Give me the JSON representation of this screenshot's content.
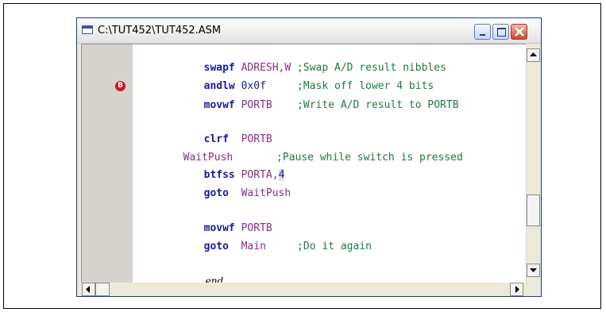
{
  "window": {
    "title": "C:\\TUT452\\TUT452.ASM"
  },
  "editor": {
    "breakpoint_marker": "B",
    "lines": [
      {
        "a": "swapf",
        "b": " ADRESH,W",
        "c": " ;Swap A/D result nibbles"
      },
      {
        "a": "andlw",
        "b": " 0x0f",
        "c": "     ;Mask off lower 4 bits"
      },
      {
        "a": "movwf",
        "b": " PORTB",
        "c": "    ;Write A/D result to PORTB"
      },
      {
        "a": "clrf",
        "b": "  PORTB",
        "c": ""
      },
      {
        "label": "WaitPush",
        "c": "       ;Pause while switch is pressed"
      },
      {
        "a": "btfss",
        "b": " PORTA,",
        "num": "4",
        "c": ""
      },
      {
        "a": "goto",
        "b": "  WaitPush",
        "c": ""
      },
      {
        "a": "movwf",
        "b": " PORTB",
        "c": ""
      },
      {
        "a": "goto",
        "b": "  Main",
        "c": "     ;Do it again"
      },
      {
        "end": "end"
      }
    ]
  },
  "colors": {
    "keyword": "#1a1a9e",
    "register": "#8b2b8b",
    "comment": "#1b7a44",
    "gutter": "#d6d3ce",
    "breakpoint": "#d01818"
  }
}
